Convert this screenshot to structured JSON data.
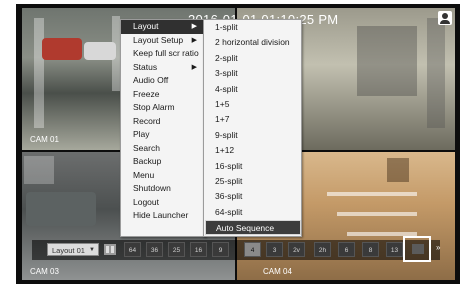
{
  "timestamp": "2016-01-01 01:10:25 PM",
  "cameras": [
    {
      "label": "CAM 01"
    },
    {
      "label": ""
    },
    {
      "label": "CAM 03"
    },
    {
      "label": "CAM 04"
    }
  ],
  "context_menu": {
    "items": [
      {
        "label": "Layout",
        "arrow": "▶"
      },
      {
        "label": "Layout Setup",
        "arrow": "▶"
      },
      {
        "label": "Keep full scr ratio",
        "arrow": ""
      },
      {
        "label": "Status",
        "arrow": "▶"
      },
      {
        "label": "Audio Off",
        "arrow": ""
      },
      {
        "label": "Freeze",
        "arrow": ""
      },
      {
        "label": "Stop Alarm",
        "arrow": ""
      },
      {
        "label": "Record",
        "arrow": ""
      },
      {
        "label": "Play",
        "arrow": ""
      },
      {
        "label": "Search",
        "arrow": ""
      },
      {
        "label": "Backup",
        "arrow": ""
      },
      {
        "label": "Menu",
        "arrow": ""
      },
      {
        "label": "Shutdown",
        "arrow": ""
      },
      {
        "label": "Logout",
        "arrow": ""
      },
      {
        "label": "Hide Launcher",
        "arrow": ""
      }
    ]
  },
  "layout_submenu": {
    "items": [
      "1-split",
      "2 horizontal division",
      "2-split",
      "3-split",
      "4-split",
      "1+5",
      "1+7",
      "9-split",
      "1+12",
      "16-split",
      "25-split",
      "36-split",
      "64-split"
    ],
    "auto_sequence": "Auto Sequence"
  },
  "launcher": {
    "layout_select": "Layout 01",
    "split_buttons": [
      "64",
      "36",
      "25",
      "16",
      "9",
      "4",
      "3",
      "2v",
      "2h",
      "6",
      "8",
      "13"
    ],
    "selected_split": "4",
    "more_icon": "»"
  }
}
